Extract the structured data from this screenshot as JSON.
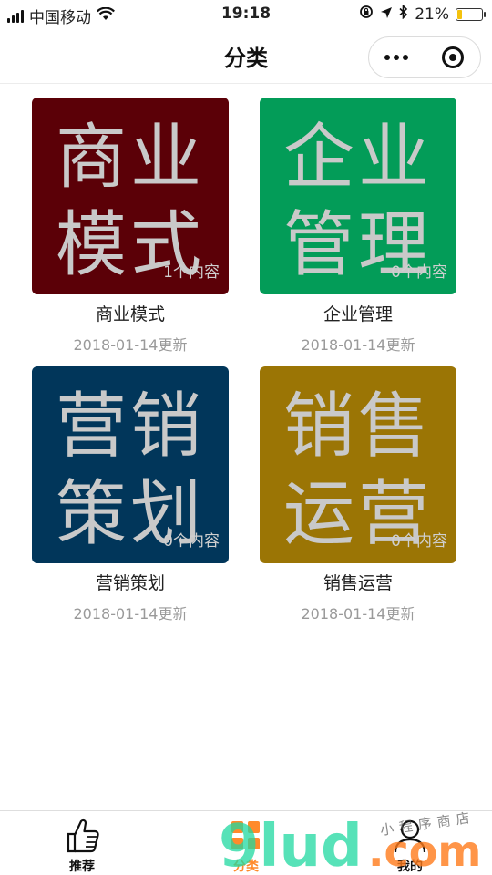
{
  "status_bar": {
    "carrier": "中国移动",
    "time": "19:18",
    "battery": "21%",
    "battery_level": 0.21,
    "battery_color": "#f4c20d"
  },
  "nav": {
    "title": "分类",
    "more_icon": "more-dots-icon",
    "close_icon": "target-circle-icon"
  },
  "categories": [
    {
      "tile_text": "商业\n模式",
      "count": "1个内容",
      "name": "商业模式",
      "date": "2018-01-14更新",
      "color": "#5b0007"
    },
    {
      "tile_text": "企业\n管理",
      "count": "0个内容",
      "name": "企业管理",
      "date": "2018-01-14更新",
      "color": "#039c58"
    },
    {
      "tile_text": "营销\n策划",
      "count": "0个内容",
      "name": "营销策划",
      "date": "2018-01-14更新",
      "color": "#01365a"
    },
    {
      "tile_text": "销售\n运营",
      "count": "0个内容",
      "name": "销售运营",
      "date": "2018-01-14更新",
      "color": "#9b7505"
    }
  ],
  "tabs": [
    {
      "label": "推荐",
      "icon": "thumbs-up-icon"
    },
    {
      "label": "分类",
      "icon": "category-grid-icon",
      "active": true
    },
    {
      "label": "我的",
      "icon": "user-icon"
    }
  ],
  "watermark": {
    "brand": "9lud",
    "domain": ".com",
    "slogan": "小程序商店"
  }
}
